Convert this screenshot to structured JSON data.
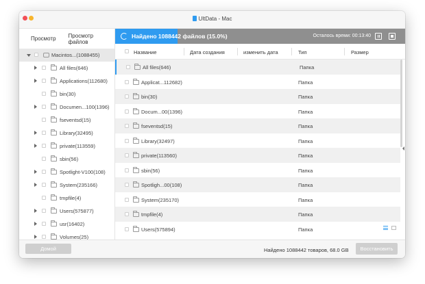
{
  "window": {
    "title": "UltData - Mac"
  },
  "sidebar": {
    "tabs": [
      "Просмотр",
      "Просмотр файлов"
    ],
    "tree": [
      {
        "label": "Macintos...(1088455)",
        "expander": "down",
        "icon": "drive-icon",
        "selected": true
      },
      {
        "label": "All files(646)",
        "expander": "right",
        "icon": "folder-icon"
      },
      {
        "label": "Applications(112680)",
        "expander": "right",
        "icon": "folder-icon"
      },
      {
        "label": "bin(30)",
        "expander": "none",
        "icon": "folder-icon"
      },
      {
        "label": "Documen...100(1396)",
        "expander": "right",
        "icon": "folder-icon"
      },
      {
        "label": "fseventsd(15)",
        "expander": "none",
        "icon": "folder-icon"
      },
      {
        "label": "Library(32495)",
        "expander": "right",
        "icon": "folder-icon"
      },
      {
        "label": "private(113559)",
        "expander": "right",
        "icon": "folder-icon"
      },
      {
        "label": "sbin(56)",
        "expander": "none",
        "icon": "folder-icon"
      },
      {
        "label": "Spotlight-V100(108)",
        "expander": "right",
        "icon": "folder-icon"
      },
      {
        "label": "System(235166)",
        "expander": "right",
        "icon": "folder-icon"
      },
      {
        "label": "tmpfile(4)",
        "expander": "none",
        "icon": "folder-icon"
      },
      {
        "label": "Users(575877)",
        "expander": "right",
        "icon": "folder-icon"
      },
      {
        "label": "usr(16402)",
        "expander": "right",
        "icon": "folder-icon"
      },
      {
        "label": "Volumes(25)",
        "expander": "right",
        "icon": "folder-icon"
      }
    ]
  },
  "status": {
    "found_text": "Найдено 1088442 файлов (15.0%)",
    "progress_percent": 15.0,
    "time_left": "Осталось времи: 00:13:40",
    "bar_color": "#2f9bf0",
    "track_color": "#8f8f8f"
  },
  "table": {
    "columns": [
      "Название",
      "Дата создания",
      "изменить дата",
      "Тип",
      "Размер"
    ],
    "rows": [
      {
        "name": "All files(646)",
        "type": "Папка"
      },
      {
        "name": "Applicat...112682)",
        "type": "Папка"
      },
      {
        "name": "bin(30)",
        "type": "Папка"
      },
      {
        "name": "Docum...00(1396)",
        "type": "Папка"
      },
      {
        "name": "fseventsd(15)",
        "type": "Папка"
      },
      {
        "name": "Library(32497)",
        "type": "Папка"
      },
      {
        "name": "private(113560)",
        "type": "Папка"
      },
      {
        "name": "sbin(56)",
        "type": "Папка"
      },
      {
        "name": "Spotligh...00(108)",
        "type": "Папка"
      },
      {
        "name": "System(235170)",
        "type": "Папка"
      },
      {
        "name": "tmpfile(4)",
        "type": "Папка"
      },
      {
        "name": "Users(575894)",
        "type": "Папка"
      }
    ]
  },
  "footer": {
    "home_label": "Домой",
    "summary": "Найдено 1088442 товаров, 68.0 GB",
    "restore_label": "Восстановить"
  },
  "icons": {
    "close": "close-icon",
    "minimize": "minimize-icon",
    "pause": "pause-icon",
    "stop": "stop-icon",
    "list_view": "list-view-icon",
    "grid_view": "grid-view-icon"
  }
}
